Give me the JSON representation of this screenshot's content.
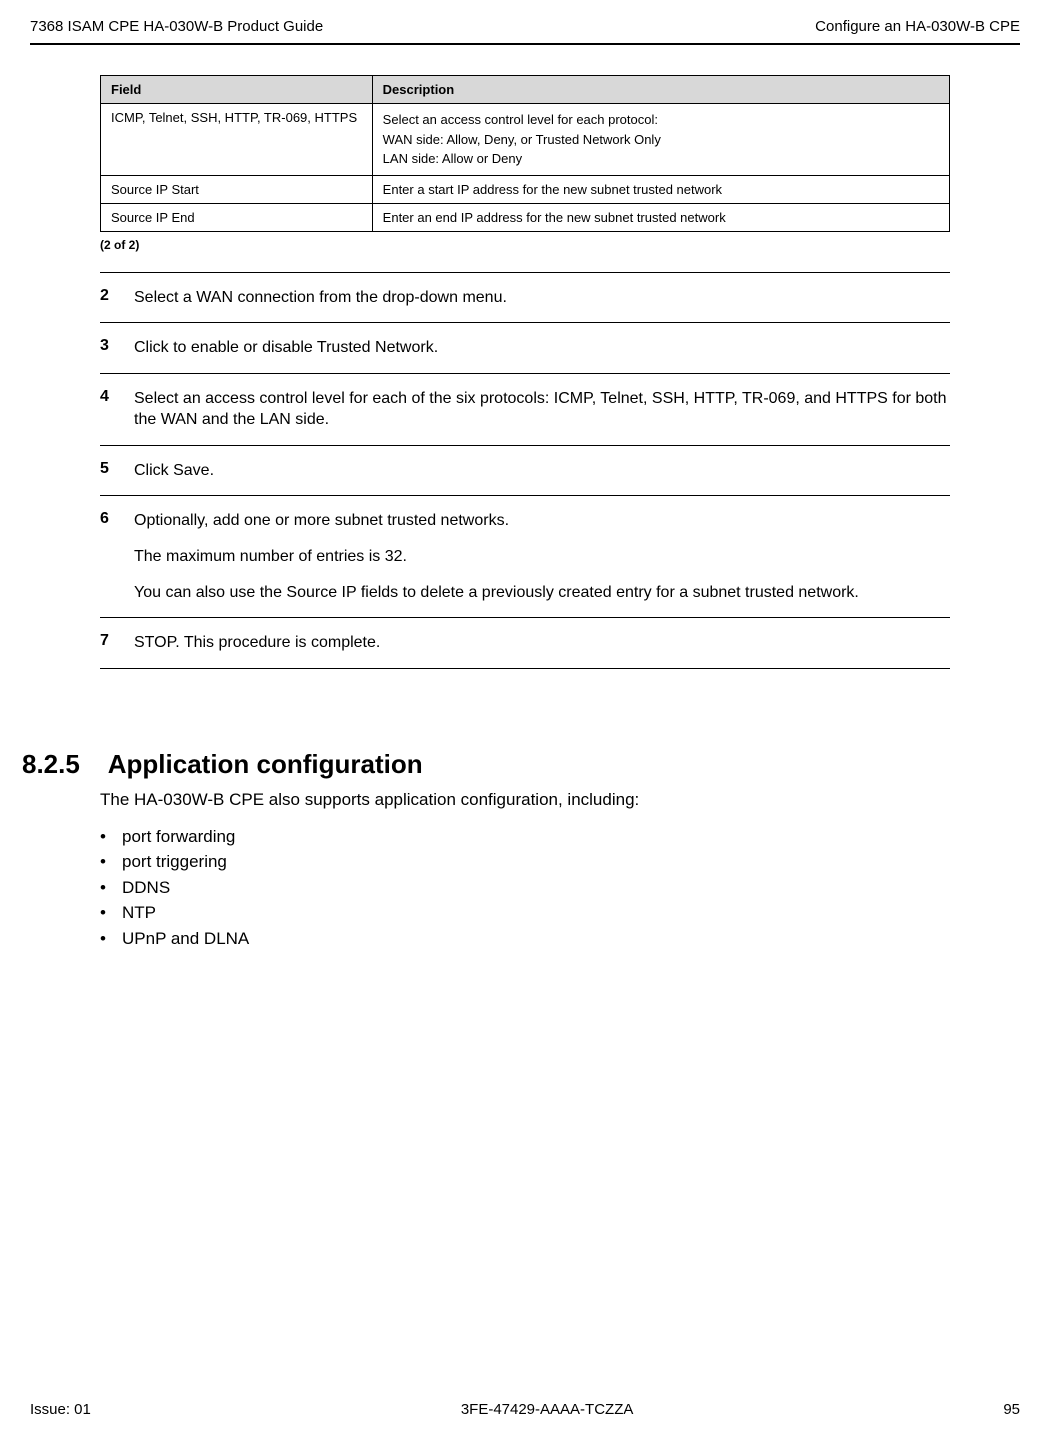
{
  "header": {
    "left": "7368 ISAM CPE HA-030W-B Product Guide",
    "right": "Configure an HA-030W-B CPE"
  },
  "table": {
    "col_field": "Field",
    "col_desc": "Description",
    "rows": [
      {
        "field": "ICMP, Telnet, SSH, HTTP, TR-069, HTTPS",
        "desc": [
          "Select an access control level for each protocol:",
          "WAN side: Allow, Deny, or Trusted Network Only",
          "LAN side: Allow or Deny"
        ]
      },
      {
        "field": "Source IP Start",
        "desc": [
          "Enter a start IP address for the new subnet trusted network"
        ]
      },
      {
        "field": "Source IP End",
        "desc": [
          "Enter an end IP address for the new subnet trusted network"
        ]
      }
    ],
    "caption": "(2 of 2)"
  },
  "steps": [
    {
      "num": "2",
      "paras": [
        "Select a WAN connection from the drop-down menu."
      ]
    },
    {
      "num": "3",
      "paras": [
        "Click to enable or disable Trusted Network."
      ]
    },
    {
      "num": "4",
      "paras": [
        "Select an access control level for each of the six protocols: ICMP, Telnet, SSH, HTTP, TR-069, and HTTPS for both the WAN and the LAN side."
      ]
    },
    {
      "num": "5",
      "paras": [
        "Click Save."
      ]
    },
    {
      "num": "6",
      "paras": [
        "Optionally, add one or more subnet trusted networks.",
        "The maximum number of entries is 32.",
        "You can also use the Source IP fields to delete a previously created entry for a subnet trusted network."
      ]
    },
    {
      "num": "7",
      "paras": [
        "STOP. This procedure is complete."
      ]
    }
  ],
  "section": {
    "heading_num": "8.2.5",
    "heading_title": "Application configuration",
    "intro": "The HA-030W-B CPE also supports application configuration, including:",
    "bullets": [
      "port forwarding",
      "port triggering",
      "DDNS",
      "NTP",
      "UPnP and DLNA"
    ]
  },
  "footer": {
    "left": "Issue: 01",
    "center": "3FE-47429-AAAA-TCZZA",
    "right": "95"
  }
}
